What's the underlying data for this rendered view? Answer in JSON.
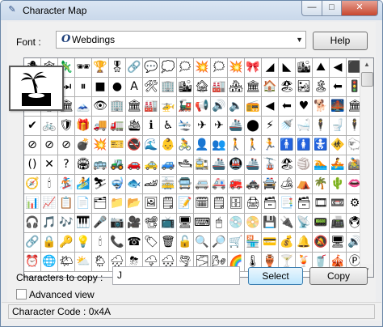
{
  "window": {
    "title": "Character Map",
    "controls": {
      "minimize": "—",
      "maximize": "□",
      "close": "✕"
    }
  },
  "font": {
    "label": "Font :",
    "selected": "Webdings",
    "icon_glyph": "O",
    "help_label": "Help"
  },
  "grid": {
    "columns": 20,
    "rows": 11,
    "enlarged_index": 42,
    "cells": [
      "🕷",
      "🕸",
      "🦎",
      "🕶",
      "🏆",
      "🎖",
      "🔗",
      "💬",
      "💭",
      "🗯",
      "💥",
      "🗯",
      "💥",
      "🎀",
      "◢",
      "◣",
      "🏙",
      "⛰",
      "◀",
      "⬛",
      "▶",
      "⏮",
      "⏭",
      "⏸",
      "■",
      "●",
      "A",
      "🛠",
      "🏢",
      "🏙",
      "🏚",
      "🏭",
      "🏘",
      "🏛",
      "🏠",
      "🏖",
      "🏜",
      "🏝",
      "⬅",
      "🚦",
      "✔",
      "🏚",
      "🏛",
      "🗻",
      "👁",
      "🏢",
      "🏛",
      "🏭",
      "🚁",
      "🚂",
      "📢",
      "🔊",
      "🔈",
      "📻",
      "◀",
      "⬅",
      "♥",
      "🐕",
      "🌉",
      "🏛",
      "✔",
      "🚲",
      "🛡",
      "🎁",
      "🚚",
      "🚛",
      "🛳",
      "ℹ",
      "♿",
      "🛬",
      "✈",
      "✈",
      "🚢",
      "⬤",
      "⚡",
      "🚿",
      "🛁",
      "🕴",
      "🚽",
      "🕴",
      "⊘",
      "⊘",
      "⊘",
      "💣",
      "💥",
      "🎫",
      "🚭",
      "🌊",
      "👶",
      "🚴",
      "👤",
      "👥",
      "🚶",
      "🚶",
      "🏃",
      "🚹",
      "🚺",
      "🚼",
      "🚸",
      "🐑",
      "()",
      "✕",
      "?",
      "🏟",
      "🚌",
      "🚜",
      "🚗",
      "🚕",
      "🚙",
      "🛥",
      "🚉",
      "🚢",
      "🚇",
      "🚢",
      "🚡",
      "🏖",
      "🏐",
      "🏊",
      "🚣",
      "🚵",
      "🧭",
      "🕯",
      "🏂",
      "🏄",
      "⛷",
      "🤿",
      "🐟",
      "🏎",
      "🚋",
      "🚍",
      "🚐",
      "🚑",
      "🚒",
      "🚓",
      "🚔",
      "🏕",
      "⛺",
      "🌴",
      "🌵",
      "👄",
      "📊",
      "📈",
      "📋",
      "📄",
      "🗂",
      "📁",
      "📂",
      "🖼",
      "🗒",
      "📝",
      "🗓",
      "🗒",
      "🗄",
      "🖨",
      "🗃",
      "📑",
      "🗃",
      "🎞",
      "📼",
      "⚙",
      "🎧",
      "🎵",
      "🎶",
      "🎹",
      "🎤",
      "📷",
      "🎥",
      "📽",
      "📺",
      "🖥",
      "⌨",
      "🖱",
      "💿",
      "📀",
      "💾",
      "🔌",
      "📡",
      "📟",
      "📠",
      "🖲",
      "🔗",
      "🔒",
      "🔑",
      "💡",
      "🕯",
      "📞",
      "☎",
      "🏷",
      "🗑",
      "🔓",
      "🔍",
      "🔎",
      "🛒",
      "🏪",
      "💳",
      "💰",
      "🔔",
      "🔕",
      "🖥",
      "🔊",
      "⏰",
      "🌐",
      "🌤",
      "⛅",
      "🌦",
      "🌧",
      "⛈",
      "🌩",
      "🌨",
      "🌪",
      "🌫",
      "🌬",
      "🌈",
      "🌡",
      "🏺",
      "🍸",
      "🍹",
      "🥤",
      "🎪",
      "Ⓟ"
    ]
  },
  "copy": {
    "label": "Characters to copy :",
    "value": "J",
    "select_label": "Select",
    "copy_label": "Copy"
  },
  "advanced": {
    "label": "Advanced view",
    "checked": false
  },
  "status": {
    "text": "Character Code : 0x4A"
  }
}
